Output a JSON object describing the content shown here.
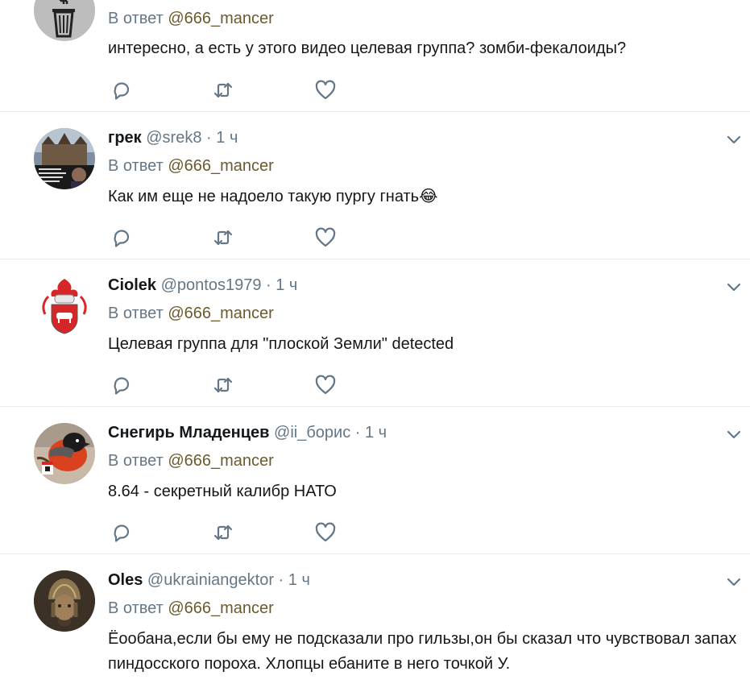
{
  "tweets": [
    {
      "name": "",
      "handle": "",
      "dot": "",
      "time": "",
      "reply_prefix": "В ответ",
      "reply_to": "@666_mancer",
      "text": "интересно, а есть у этого видео целевая группа? зомби-фекалоиды?",
      "avatar_icon": "anti-swastika-trash-avatar"
    },
    {
      "name": "грек",
      "handle": "@srek8",
      "dot": "·",
      "time": "1 ч",
      "reply_prefix": "В ответ",
      "reply_to": "@666_mancer",
      "text": "Как им еще не надоело  такую пургу гнать😂",
      "avatar_icon": "castle-photo-avatar"
    },
    {
      "name": "Ciolek",
      "handle": "@pontos1979",
      "dot": "·",
      "time": "1 ч",
      "reply_prefix": "В ответ",
      "reply_to": "@666_mancer",
      "text": "Целевая группа для \"плоской Земли\" detected",
      "avatar_icon": "coat-of-arms-avatar"
    },
    {
      "name": "Снегирь Младенцев",
      "handle": "@ii_борис",
      "dot": "·",
      "time": "1 ч",
      "reply_prefix": "В ответ",
      "reply_to": "@666_mancer",
      "text": "8.64 - секретный калибр НАТО",
      "avatar_icon": "bullfinch-avatar"
    },
    {
      "name": "Oles",
      "handle": "@ukrainiangektor",
      "dot": "·",
      "time": "1 ч",
      "reply_prefix": "В ответ",
      "reply_to": "@666_mancer",
      "text": "Ёообана,если бы ему не подсказали про гильзы,он бы сказал что чувствовал запах пиндосского пороха. Хлопцы ебаните в него точкой У.",
      "avatar_icon": "helmet-portrait-avatar"
    }
  ],
  "colors": {
    "accent_mention": "#6b5a2c",
    "muted": "#657786",
    "divider": "#e6ecf0"
  }
}
